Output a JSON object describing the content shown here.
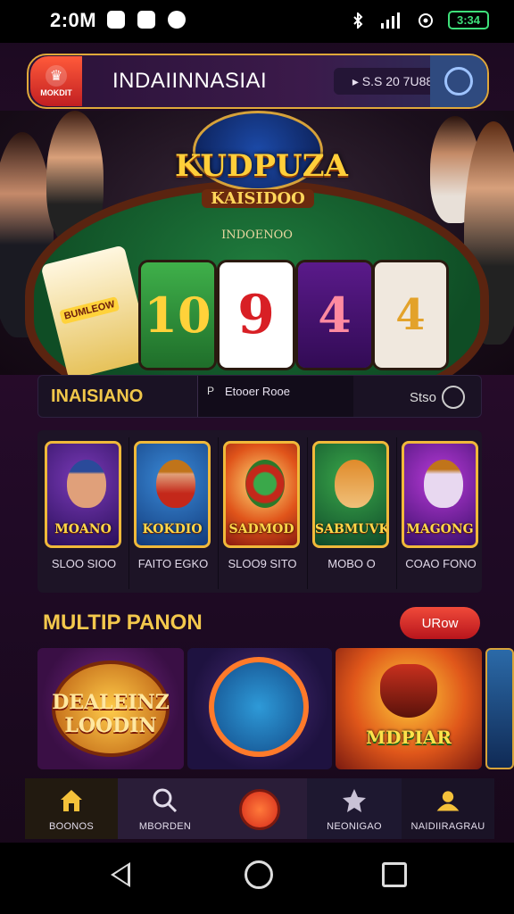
{
  "status_bar": {
    "time": "2:0M",
    "battery": "3:34"
  },
  "header": {
    "logo_text": "MOKDIT",
    "brand": "INDAIINNASIAI",
    "balance": "▸ S.S 20 7U88"
  },
  "hero": {
    "title": "KUDPUZA",
    "subtitle": "KAISIDOO",
    "felt_label": "INDOENOO",
    "reels": [
      "10",
      "9",
      "4",
      "4"
    ],
    "side_card_label": "BUMLEOW"
  },
  "search_row": {
    "title": "INAISIANO",
    "mid_prefix": "P",
    "mid_text": "Etooer Rooe",
    "right_label": "Stso"
  },
  "games": [
    {
      "name": "MOANO",
      "caption": "SLOO SIOO"
    },
    {
      "name": "KOKDIO",
      "caption": "FAITO EGKO"
    },
    {
      "name": "SADMOD",
      "caption": "SLOO9 SITO"
    },
    {
      "name": "SABMUVK",
      "caption": "MOBO O"
    },
    {
      "name": "MAGONG",
      "caption": "COAO FONO"
    }
  ],
  "section": {
    "title": "MULTIP PANON",
    "more_button": "URow"
  },
  "banners": [
    {
      "text": "DEALEINZ LOODIN"
    },
    {
      "text": ""
    },
    {
      "text": "MDPIAR"
    }
  ],
  "bottom_nav": [
    {
      "label": "BOONOS",
      "icon": "home-icon"
    },
    {
      "label": "MBORDEN",
      "icon": "search-icon"
    },
    {
      "label": "",
      "icon": "play-icon"
    },
    {
      "label": "NEONIGAO",
      "icon": "star-icon"
    },
    {
      "label": "NAIDIIRAGRAU",
      "icon": "account-icon"
    }
  ],
  "colors": {
    "accent_gold": "#f3c84c",
    "accent_red": "#d62a1a",
    "bg": "#1f0a25",
    "battery": "#3ee07a"
  }
}
